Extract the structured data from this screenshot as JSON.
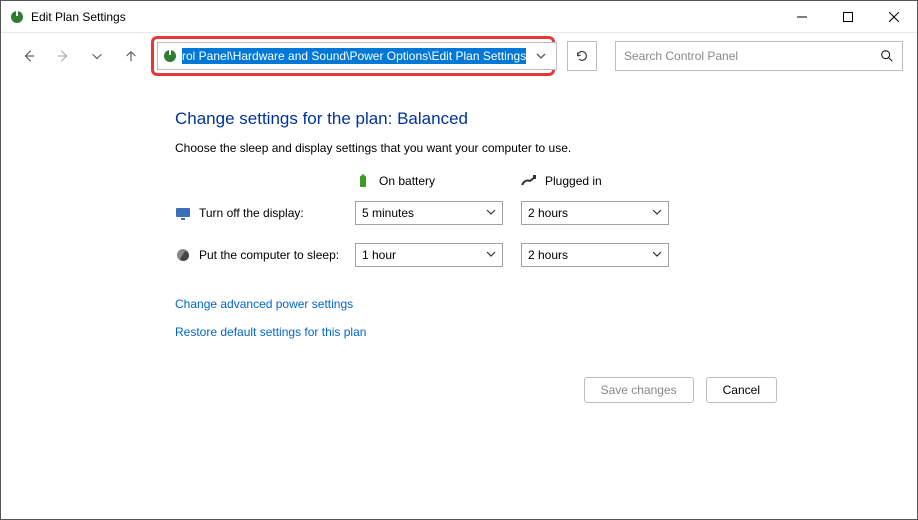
{
  "window": {
    "title": "Edit Plan Settings"
  },
  "address": {
    "path": "rol Panel\\Hardware and Sound\\Power Options\\Edit Plan Settings"
  },
  "search": {
    "placeholder": "Search Control Panel"
  },
  "page": {
    "heading": "Change settings for the plan: Balanced",
    "description": "Choose the sleep and display settings that you want your computer to use."
  },
  "columns": {
    "battery": "On battery",
    "plugged": "Plugged in"
  },
  "rows": {
    "display": {
      "label": "Turn off the display:",
      "battery": "5 minutes",
      "plugged": "2 hours"
    },
    "sleep": {
      "label": "Put the computer to sleep:",
      "battery": "1 hour",
      "plugged": "2 hours"
    }
  },
  "links": {
    "advanced": "Change advanced power settings",
    "restore": "Restore default settings for this plan"
  },
  "buttons": {
    "save": "Save changes",
    "cancel": "Cancel"
  }
}
